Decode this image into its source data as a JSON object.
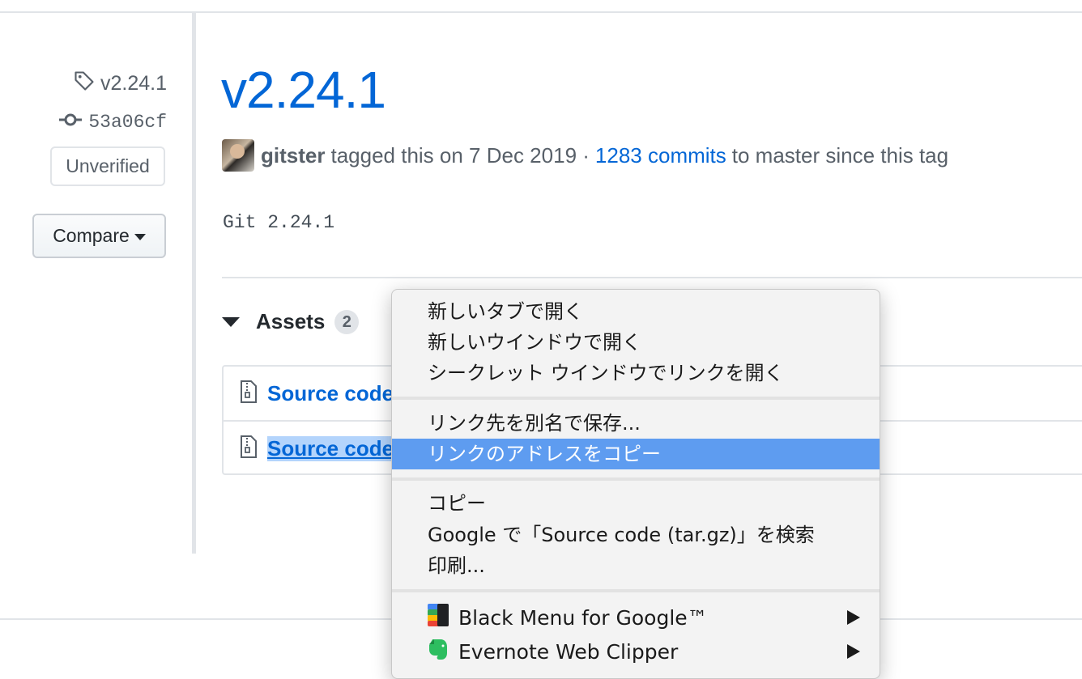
{
  "sidebar": {
    "tag_name": "v2.24.1",
    "commit_sha": "53a06cf",
    "verification_label": "Unverified",
    "compare_label": "Compare"
  },
  "release": {
    "title": "v2.24.1",
    "author": "gitster",
    "tagged_text": "tagged this on 7 Dec 2019 ·",
    "commits_link": "1283 commits",
    "since_text": "to master since this tag",
    "notes": "Git 2.24.1"
  },
  "assets": {
    "heading": "Assets",
    "count": "2",
    "items": [
      {
        "label": "Source code"
      },
      {
        "label": "Source code"
      }
    ]
  },
  "context_menu": {
    "group1": [
      "新しいタブで開く",
      "新しいウインドウで開く",
      "シークレット ウインドウでリンクを開く"
    ],
    "group2": [
      "リンク先を別名で保存...",
      "リンクのアドレスをコピー"
    ],
    "group3": [
      "コピー",
      "Google で「Source code (tar.gz)」を検索",
      "印刷..."
    ],
    "extensions": [
      {
        "label": "Black Menu for Google™",
        "icon": "black-menu-icon"
      },
      {
        "label": "Evernote Web Clipper",
        "icon": "evernote-elephant-icon"
      }
    ],
    "highlighted": "リンクのアドレスをコピー"
  },
  "colors": {
    "link": "#0366d6",
    "menu_highlight": "#5e9cf0",
    "selection": "#b3d4fc"
  }
}
